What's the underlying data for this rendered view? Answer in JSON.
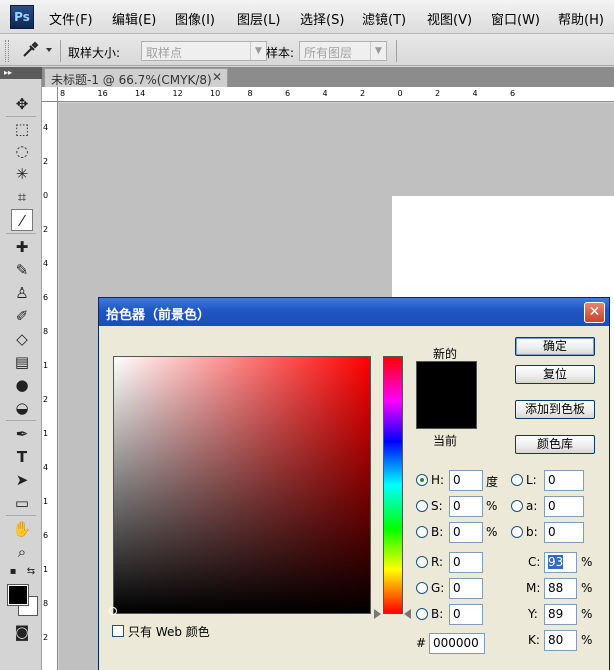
{
  "app": {
    "logo": "Ps"
  },
  "menu": [
    "文件(F)",
    "编辑(E)",
    "图像(I)",
    "图层(L)",
    "选择(S)",
    "滤镜(T)",
    "视图(V)",
    "窗口(W)",
    "帮助(H)"
  ],
  "options": {
    "sample_size_label": "取样大小:",
    "sample_size_value": "取样点",
    "sample_label": "样本:",
    "sample_value": "所有图层"
  },
  "document": {
    "tab_title": "未标题-1 @ 66.7%(CMYK/8)",
    "close": "✕"
  },
  "ruler": {
    "h_ticks": [
      "8",
      "16",
      "14",
      "12",
      "10",
      "8",
      "6",
      "4",
      "2",
      "0",
      "2",
      "4",
      "6"
    ],
    "v_ticks": [
      "4",
      "2",
      "0",
      "2",
      "4",
      "6",
      "8",
      "1",
      "2",
      "1",
      "4",
      "1",
      "6",
      "1",
      "8",
      "2"
    ]
  },
  "dialog": {
    "title": "拾色器（前景色）",
    "new_label": "新的",
    "current_label": "当前",
    "buttons": {
      "ok": "确定",
      "reset": "复位",
      "add_swatch": "添加到色板",
      "color_library": "颜色库"
    },
    "only_web": "只有 Web 颜色",
    "hsb": [
      {
        "key": "H:",
        "value": "0",
        "unit": "度"
      },
      {
        "key": "S:",
        "value": "0",
        "unit": "%"
      },
      {
        "key": "B:",
        "value": "0",
        "unit": "%"
      }
    ],
    "lab": [
      {
        "key": "L:",
        "value": "0"
      },
      {
        "key": "a:",
        "value": "0"
      },
      {
        "key": "b:",
        "value": "0"
      }
    ],
    "rgb": [
      {
        "key": "R:",
        "value": "0"
      },
      {
        "key": "G:",
        "value": "0"
      },
      {
        "key": "B:",
        "value": "0"
      }
    ],
    "cmyk": [
      {
        "key": "C:",
        "value": "93",
        "unit": "%"
      },
      {
        "key": "M:",
        "value": "88",
        "unit": "%"
      },
      {
        "key": "Y:",
        "value": "89",
        "unit": "%"
      },
      {
        "key": "K:",
        "value": "80",
        "unit": "%"
      }
    ],
    "hex_label": "#",
    "hex_value": "000000",
    "preview_colors": {
      "new": "#000000",
      "current": "#000000"
    }
  }
}
